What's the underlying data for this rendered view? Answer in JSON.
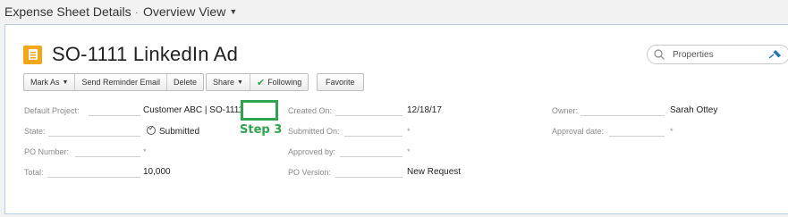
{
  "breadcrumb": {
    "root": "Expense Sheet Details",
    "separator": "·",
    "view": "Overview View"
  },
  "record": {
    "title": "SO-1111 LinkedIn Ad",
    "icon": "expense-sheet-icon"
  },
  "search": {
    "placeholder": "Properties"
  },
  "actions": {
    "mark_as": "Mark As",
    "send_reminder": "Send Reminder Email",
    "delete": "Delete",
    "share": "Share",
    "following": "Following",
    "favorite": "Favorite"
  },
  "fields": {
    "default_project": {
      "label": "Default Project:",
      "value": "Customer ABC | SO-1111"
    },
    "state": {
      "label": "State:",
      "value": "Submitted"
    },
    "po_number": {
      "label": "PO Number:",
      "value": "*"
    },
    "total": {
      "label": "Total:",
      "value": "10,000"
    },
    "created_on": {
      "label": "Created On:",
      "value": "12/18/17"
    },
    "submitted_on": {
      "label": "Submitted On:",
      "value": "*"
    },
    "approved_by": {
      "label": "Approved by:",
      "value": "*"
    },
    "po_version": {
      "label": "PO Version:",
      "value": "New Request"
    },
    "owner": {
      "label": "Owner:",
      "value": "Sarah Ottey"
    },
    "approval_date": {
      "label": "Approval date:",
      "value": "*"
    }
  },
  "annotation": {
    "step": "Step 3"
  },
  "colors": {
    "accent_green": "#2ea44f",
    "icon_orange": "#f2a71b",
    "card_border": "#b9cde6"
  }
}
